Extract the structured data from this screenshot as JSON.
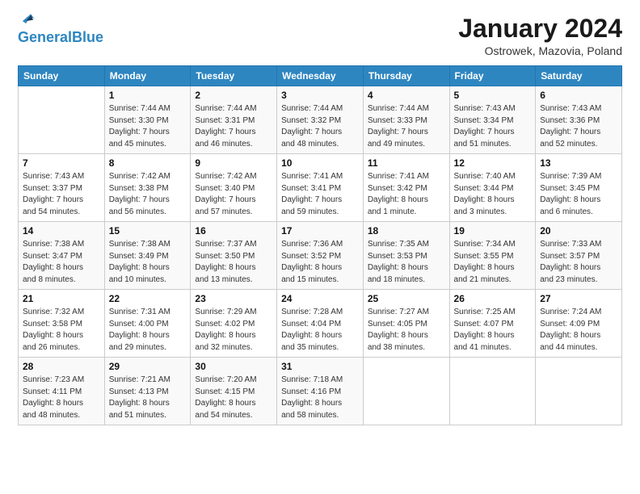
{
  "header": {
    "logo_line1": "General",
    "logo_line2": "Blue",
    "month": "January 2024",
    "location": "Ostrowek, Mazovia, Poland"
  },
  "days_of_week": [
    "Sunday",
    "Monday",
    "Tuesday",
    "Wednesday",
    "Thursday",
    "Friday",
    "Saturday"
  ],
  "weeks": [
    [
      {
        "day": "",
        "info": ""
      },
      {
        "day": "1",
        "info": "Sunrise: 7:44 AM\nSunset: 3:30 PM\nDaylight: 7 hours\nand 45 minutes."
      },
      {
        "day": "2",
        "info": "Sunrise: 7:44 AM\nSunset: 3:31 PM\nDaylight: 7 hours\nand 46 minutes."
      },
      {
        "day": "3",
        "info": "Sunrise: 7:44 AM\nSunset: 3:32 PM\nDaylight: 7 hours\nand 48 minutes."
      },
      {
        "day": "4",
        "info": "Sunrise: 7:44 AM\nSunset: 3:33 PM\nDaylight: 7 hours\nand 49 minutes."
      },
      {
        "day": "5",
        "info": "Sunrise: 7:43 AM\nSunset: 3:34 PM\nDaylight: 7 hours\nand 51 minutes."
      },
      {
        "day": "6",
        "info": "Sunrise: 7:43 AM\nSunset: 3:36 PM\nDaylight: 7 hours\nand 52 minutes."
      }
    ],
    [
      {
        "day": "7",
        "info": "Sunrise: 7:43 AM\nSunset: 3:37 PM\nDaylight: 7 hours\nand 54 minutes."
      },
      {
        "day": "8",
        "info": "Sunrise: 7:42 AM\nSunset: 3:38 PM\nDaylight: 7 hours\nand 56 minutes."
      },
      {
        "day": "9",
        "info": "Sunrise: 7:42 AM\nSunset: 3:40 PM\nDaylight: 7 hours\nand 57 minutes."
      },
      {
        "day": "10",
        "info": "Sunrise: 7:41 AM\nSunset: 3:41 PM\nDaylight: 7 hours\nand 59 minutes."
      },
      {
        "day": "11",
        "info": "Sunrise: 7:41 AM\nSunset: 3:42 PM\nDaylight: 8 hours\nand 1 minute."
      },
      {
        "day": "12",
        "info": "Sunrise: 7:40 AM\nSunset: 3:44 PM\nDaylight: 8 hours\nand 3 minutes."
      },
      {
        "day": "13",
        "info": "Sunrise: 7:39 AM\nSunset: 3:45 PM\nDaylight: 8 hours\nand 6 minutes."
      }
    ],
    [
      {
        "day": "14",
        "info": "Sunrise: 7:38 AM\nSunset: 3:47 PM\nDaylight: 8 hours\nand 8 minutes."
      },
      {
        "day": "15",
        "info": "Sunrise: 7:38 AM\nSunset: 3:49 PM\nDaylight: 8 hours\nand 10 minutes."
      },
      {
        "day": "16",
        "info": "Sunrise: 7:37 AM\nSunset: 3:50 PM\nDaylight: 8 hours\nand 13 minutes."
      },
      {
        "day": "17",
        "info": "Sunrise: 7:36 AM\nSunset: 3:52 PM\nDaylight: 8 hours\nand 15 minutes."
      },
      {
        "day": "18",
        "info": "Sunrise: 7:35 AM\nSunset: 3:53 PM\nDaylight: 8 hours\nand 18 minutes."
      },
      {
        "day": "19",
        "info": "Sunrise: 7:34 AM\nSunset: 3:55 PM\nDaylight: 8 hours\nand 21 minutes."
      },
      {
        "day": "20",
        "info": "Sunrise: 7:33 AM\nSunset: 3:57 PM\nDaylight: 8 hours\nand 23 minutes."
      }
    ],
    [
      {
        "day": "21",
        "info": "Sunrise: 7:32 AM\nSunset: 3:58 PM\nDaylight: 8 hours\nand 26 minutes."
      },
      {
        "day": "22",
        "info": "Sunrise: 7:31 AM\nSunset: 4:00 PM\nDaylight: 8 hours\nand 29 minutes."
      },
      {
        "day": "23",
        "info": "Sunrise: 7:29 AM\nSunset: 4:02 PM\nDaylight: 8 hours\nand 32 minutes."
      },
      {
        "day": "24",
        "info": "Sunrise: 7:28 AM\nSunset: 4:04 PM\nDaylight: 8 hours\nand 35 minutes."
      },
      {
        "day": "25",
        "info": "Sunrise: 7:27 AM\nSunset: 4:05 PM\nDaylight: 8 hours\nand 38 minutes."
      },
      {
        "day": "26",
        "info": "Sunrise: 7:25 AM\nSunset: 4:07 PM\nDaylight: 8 hours\nand 41 minutes."
      },
      {
        "day": "27",
        "info": "Sunrise: 7:24 AM\nSunset: 4:09 PM\nDaylight: 8 hours\nand 44 minutes."
      }
    ],
    [
      {
        "day": "28",
        "info": "Sunrise: 7:23 AM\nSunset: 4:11 PM\nDaylight: 8 hours\nand 48 minutes."
      },
      {
        "day": "29",
        "info": "Sunrise: 7:21 AM\nSunset: 4:13 PM\nDaylight: 8 hours\nand 51 minutes."
      },
      {
        "day": "30",
        "info": "Sunrise: 7:20 AM\nSunset: 4:15 PM\nDaylight: 8 hours\nand 54 minutes."
      },
      {
        "day": "31",
        "info": "Sunrise: 7:18 AM\nSunset: 4:16 PM\nDaylight: 8 hours\nand 58 minutes."
      },
      {
        "day": "",
        "info": ""
      },
      {
        "day": "",
        "info": ""
      },
      {
        "day": "",
        "info": ""
      }
    ]
  ]
}
